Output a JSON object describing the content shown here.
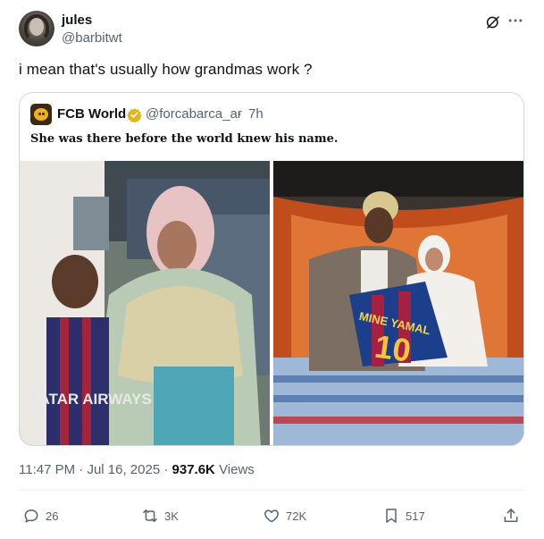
{
  "author": {
    "name": "jules",
    "handle": "@barbitwt"
  },
  "tweet": {
    "text": "i mean that's usually how grandmas work ?"
  },
  "quote": {
    "name": "FCB World",
    "handle": "@forcabarca_ar",
    "separator": "·",
    "time": "7h",
    "text": "She was there before the world knew his name.",
    "photo_left_shirt_text": "QATAR AIRWAYS",
    "photo_right_shirt_text": "MINE YAMAL",
    "photo_right_number": "10"
  },
  "meta": {
    "time": "11:47 PM",
    "date": "Jul 16, 2025",
    "separator": "·",
    "views_count": "937.6K",
    "views_label": "Views"
  },
  "actions": {
    "replies": "26",
    "reposts": "3K",
    "likes": "72K",
    "bookmarks": "517"
  },
  "icons": {
    "verified_color": "#e2b719",
    "muted_color": "#536471"
  }
}
